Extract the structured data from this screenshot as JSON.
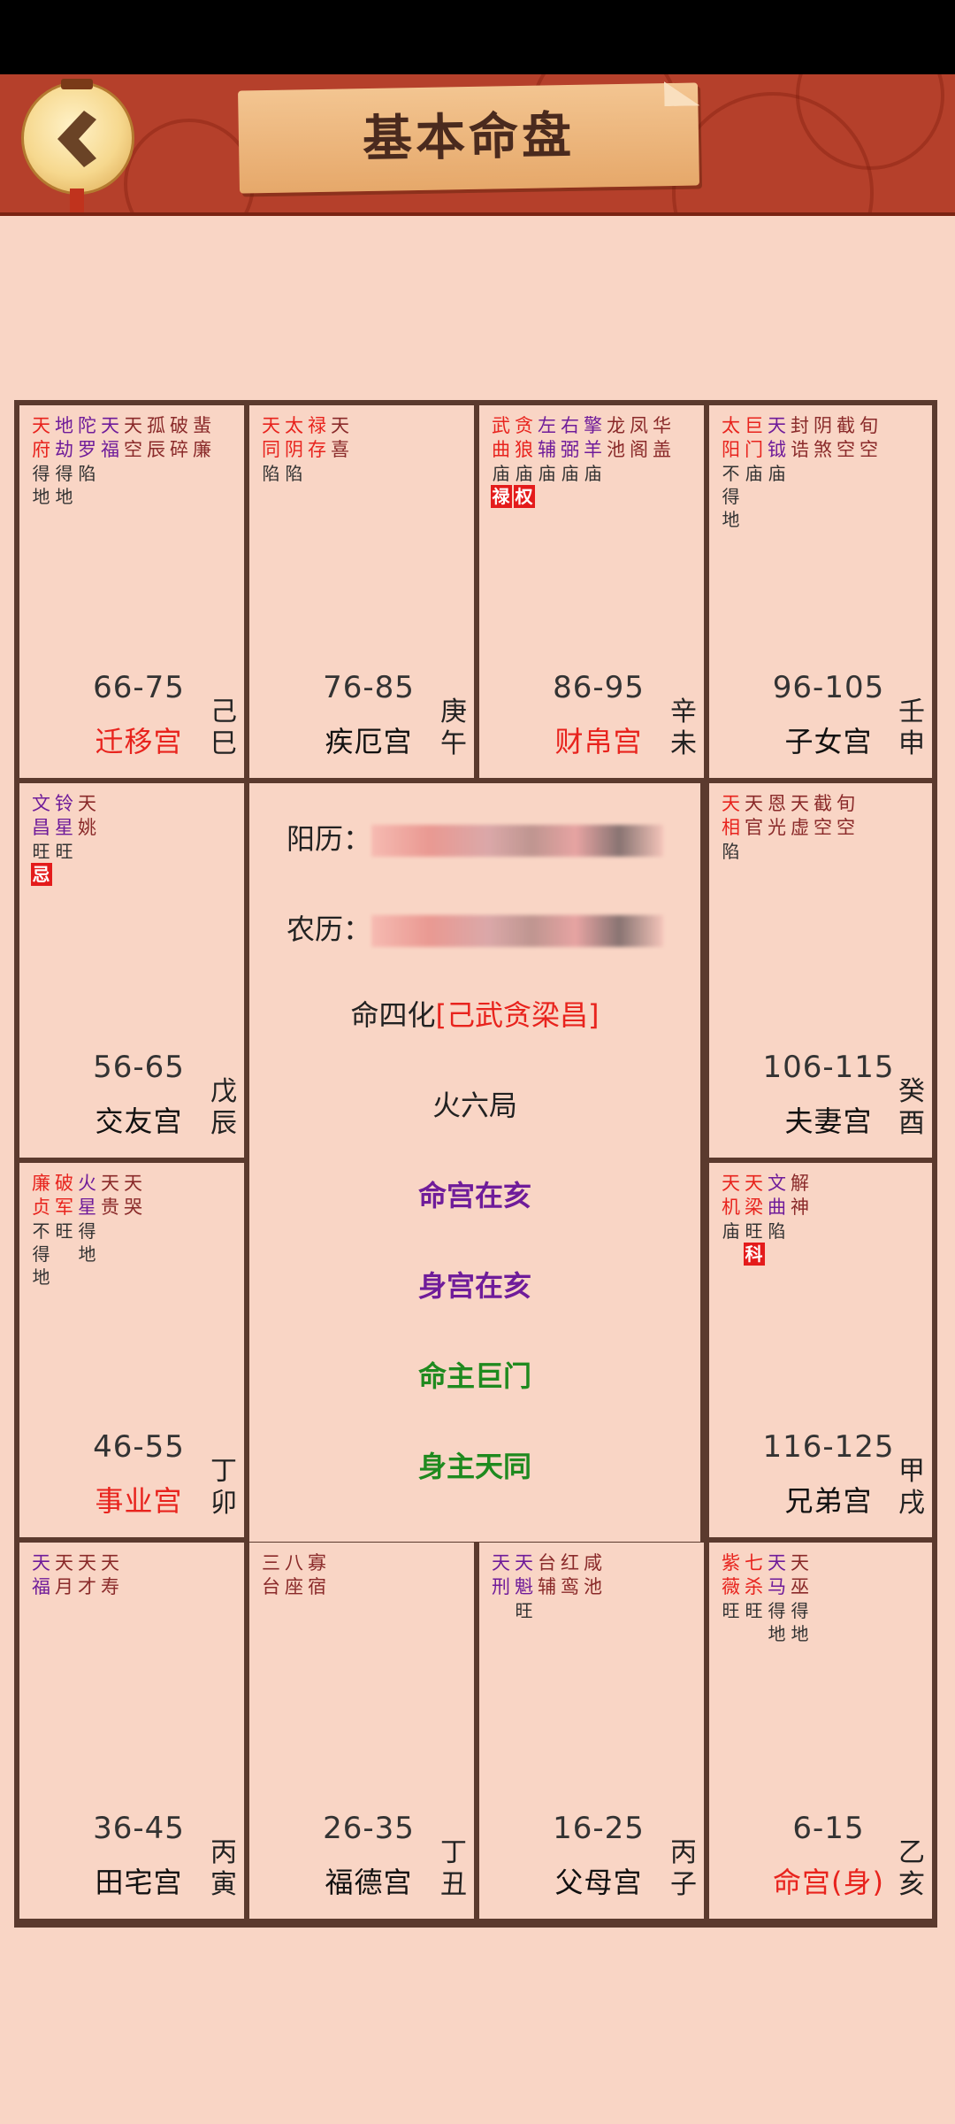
{
  "header": {
    "title": "基本命盘",
    "back_icon": "chevron-left-icon"
  },
  "colors": {
    "header_bg": "#b5402b",
    "grid_line": "#5b3a2e",
    "cell_bg": "#f9d5c5",
    "red": "#e8231d",
    "purple": "#6f1c9a",
    "green": "#1f8a1f",
    "badge": "#e41b1b"
  },
  "center": {
    "solar_label": "阳历：",
    "lunar_label": "农历：",
    "sihua_label": "命四化",
    "sihua_value": "[己武贪梁昌]",
    "ju": "火六局",
    "ming_gong": "命宫在亥",
    "shen_gong": "身宫在亥",
    "ming_zhu": "命主巨门",
    "shen_zhu": "身主天同"
  },
  "palaces": [
    {
      "id": "si",
      "range": "66-75",
      "name": "迁移宫",
      "name_red": true,
      "stem": "己",
      "branch": "巳",
      "stars": [
        {
          "top": "天",
          "bot": "府",
          "c": "#e8231d",
          "br": [
            "得",
            "地"
          ]
        },
        {
          "top": "地",
          "bot": "劫",
          "c": "#6f1c9a",
          "br": [
            "得",
            "地"
          ]
        },
        {
          "top": "陀",
          "bot": "罗",
          "c": "#6f1c9a",
          "br": [
            "陷"
          ]
        },
        {
          "top": "天",
          "bot": "福",
          "c": "#6f1c9a",
          "br": []
        },
        {
          "top": "天",
          "bot": "空",
          "c": "#8a2a2a",
          "br": []
        },
        {
          "top": "孤",
          "bot": "辰",
          "c": "#8a2a2a",
          "br": []
        },
        {
          "top": "破",
          "bot": "碎",
          "c": "#8a2a2a",
          "br": []
        },
        {
          "top": "蜚",
          "bot": "廉",
          "c": "#8a2a2a",
          "br": []
        }
      ]
    },
    {
      "id": "wu",
      "range": "76-85",
      "name": "疾厄宫",
      "name_red": false,
      "stem": "庚",
      "branch": "午",
      "stars": [
        {
          "top": "天",
          "bot": "同",
          "c": "#e8231d",
          "br": [
            "陷"
          ]
        },
        {
          "top": "太",
          "bot": "阴",
          "c": "#e8231d",
          "br": [
            "陷"
          ]
        },
        {
          "top": "禄",
          "bot": "存",
          "c": "#e8231d",
          "br": []
        },
        {
          "top": "天",
          "bot": "喜",
          "c": "#8a2a2a",
          "br": []
        }
      ]
    },
    {
      "id": "wei",
      "range": "86-95",
      "name": "财帛宫",
      "name_red": true,
      "stem": "辛",
      "branch": "未",
      "stars": [
        {
          "top": "武",
          "bot": "曲",
          "c": "#e8231d",
          "br": [
            "庙"
          ],
          "badge": "禄"
        },
        {
          "top": "贪",
          "bot": "狼",
          "c": "#e8231d",
          "br": [
            "庙"
          ],
          "badge": "权"
        },
        {
          "top": "左",
          "bot": "辅",
          "c": "#6f1c9a",
          "br": [
            "庙"
          ]
        },
        {
          "top": "右",
          "bot": "弼",
          "c": "#6f1c9a",
          "br": [
            "庙"
          ]
        },
        {
          "top": "擎",
          "bot": "羊",
          "c": "#6f1c9a",
          "br": [
            "庙"
          ]
        },
        {
          "top": "龙",
          "bot": "池",
          "c": "#8a2a2a",
          "br": []
        },
        {
          "top": "凤",
          "bot": "阁",
          "c": "#8a2a2a",
          "br": []
        },
        {
          "top": "华",
          "bot": "盖",
          "c": "#8a2a2a",
          "br": []
        }
      ]
    },
    {
      "id": "shen",
      "range": "96-105",
      "name": "子女宫",
      "name_red": false,
      "stem": "壬",
      "branch": "申",
      "stars": [
        {
          "top": "太",
          "bot": "阳",
          "c": "#e8231d",
          "br": [
            "不",
            "得",
            "地"
          ]
        },
        {
          "top": "巨",
          "bot": "门",
          "c": "#e8231d",
          "br": [
            "庙"
          ]
        },
        {
          "top": "天",
          "bot": "钺",
          "c": "#6f1c9a",
          "br": [
            "庙"
          ]
        },
        {
          "top": "封",
          "bot": "诰",
          "c": "#8a2a2a",
          "br": []
        },
        {
          "top": "阴",
          "bot": "煞",
          "c": "#8a2a2a",
          "br": []
        },
        {
          "top": "截",
          "bot": "空",
          "c": "#8a2a2a",
          "br": []
        },
        {
          "top": "旬",
          "bot": "空",
          "c": "#8a2a2a",
          "br": []
        }
      ]
    },
    {
      "id": "chen",
      "range": "56-65",
      "name": "交友宫",
      "name_red": false,
      "stem": "戊",
      "branch": "辰",
      "stars": [
        {
          "top": "文",
          "bot": "昌",
          "c": "#6f1c9a",
          "br": [
            "旺"
          ],
          "badge": "忌"
        },
        {
          "top": "铃",
          "bot": "星",
          "c": "#6f1c9a",
          "br": [
            "旺"
          ]
        },
        {
          "top": "天",
          "bot": "姚",
          "c": "#8a2a2a",
          "br": []
        }
      ]
    },
    {
      "id": "you",
      "range": "106-115",
      "name": "夫妻宫",
      "name_red": false,
      "stem": "癸",
      "branch": "酉",
      "stars": [
        {
          "top": "天",
          "bot": "相",
          "c": "#e8231d",
          "br": [
            "陷"
          ]
        },
        {
          "top": "天",
          "bot": "官",
          "c": "#8a2a2a",
          "br": []
        },
        {
          "top": "恩",
          "bot": "光",
          "c": "#8a2a2a",
          "br": []
        },
        {
          "top": "天",
          "bot": "虚",
          "c": "#8a2a2a",
          "br": []
        },
        {
          "top": "截",
          "bot": "空",
          "c": "#8a2a2a",
          "br": []
        },
        {
          "top": "旬",
          "bot": "空",
          "c": "#8a2a2a",
          "br": []
        }
      ]
    },
    {
      "id": "mao",
      "range": "46-55",
      "name": "事业宫",
      "name_red": true,
      "stem": "丁",
      "branch": "卯",
      "stars": [
        {
          "top": "廉",
          "bot": "贞",
          "c": "#e8231d",
          "br": [
            "不",
            "得",
            "地"
          ]
        },
        {
          "top": "破",
          "bot": "军",
          "c": "#e8231d",
          "br": [
            "旺"
          ]
        },
        {
          "top": "火",
          "bot": "星",
          "c": "#6f1c9a",
          "br": [
            "得",
            "地"
          ]
        },
        {
          "top": "天",
          "bot": "贵",
          "c": "#8a2a2a",
          "br": []
        },
        {
          "top": "天",
          "bot": "哭",
          "c": "#8a2a2a",
          "br": []
        }
      ]
    },
    {
      "id": "xu",
      "range": "116-125",
      "name": "兄弟宫",
      "name_red": false,
      "stem": "甲",
      "branch": "戌",
      "stars": [
        {
          "top": "天",
          "bot": "机",
          "c": "#e8231d",
          "br": [
            "庙"
          ]
        },
        {
          "top": "天",
          "bot": "梁",
          "c": "#e8231d",
          "br": [
            "旺"
          ],
          "badge": "科"
        },
        {
          "top": "文",
          "bot": "曲",
          "c": "#6f1c9a",
          "br": [
            "陷"
          ]
        },
        {
          "top": "解",
          "bot": "神",
          "c": "#8a2a2a",
          "br": []
        }
      ]
    },
    {
      "id": "yin",
      "range": "36-45",
      "name": "田宅宫",
      "name_red": false,
      "stem": "丙",
      "branch": "寅",
      "stars": [
        {
          "top": "天",
          "bot": "福",
          "c": "#6f1c9a",
          "br": []
        },
        {
          "top": "天",
          "bot": "月",
          "c": "#8a2a2a",
          "br": []
        },
        {
          "top": "天",
          "bot": "才",
          "c": "#8a2a2a",
          "br": []
        },
        {
          "top": "天",
          "bot": "寿",
          "c": "#8a2a2a",
          "br": []
        }
      ]
    },
    {
      "id": "chou",
      "range": "26-35",
      "name": "福德宫",
      "name_red": false,
      "stem": "丁",
      "branch": "丑",
      "stars": [
        {
          "top": "三",
          "bot": "台",
          "c": "#8a2a2a",
          "br": []
        },
        {
          "top": "八",
          "bot": "座",
          "c": "#8a2a2a",
          "br": []
        },
        {
          "top": "寡",
          "bot": "宿",
          "c": "#8a2a2a",
          "br": []
        }
      ]
    },
    {
      "id": "zi",
      "range": "16-25",
      "name": "父母宫",
      "name_red": false,
      "stem": "丙",
      "branch": "子",
      "stars": [
        {
          "top": "天",
          "bot": "刑",
          "c": "#6f1c9a",
          "br": []
        },
        {
          "top": "天",
          "bot": "魁",
          "c": "#6f1c9a",
          "br": [
            "旺"
          ]
        },
        {
          "top": "台",
          "bot": "辅",
          "c": "#8a2a2a",
          "br": []
        },
        {
          "top": "红",
          "bot": "鸾",
          "c": "#8a2a2a",
          "br": []
        },
        {
          "top": "咸",
          "bot": "池",
          "c": "#8a2a2a",
          "br": []
        }
      ]
    },
    {
      "id": "hai",
      "range": "6-15",
      "name": "命宫(身)",
      "name_red": true,
      "stem": "乙",
      "branch": "亥",
      "stars": [
        {
          "top": "紫",
          "bot": "薇",
          "c": "#e8231d",
          "br": [
            "旺"
          ]
        },
        {
          "top": "七",
          "bot": "杀",
          "c": "#e8231d",
          "br": [
            "旺"
          ]
        },
        {
          "top": "天",
          "bot": "马",
          "c": "#6f1c9a",
          "br": [
            "得",
            "地"
          ]
        },
        {
          "top": "天",
          "bot": "巫",
          "c": "#8a2a2a",
          "br": [
            "得",
            "地"
          ]
        }
      ]
    }
  ]
}
